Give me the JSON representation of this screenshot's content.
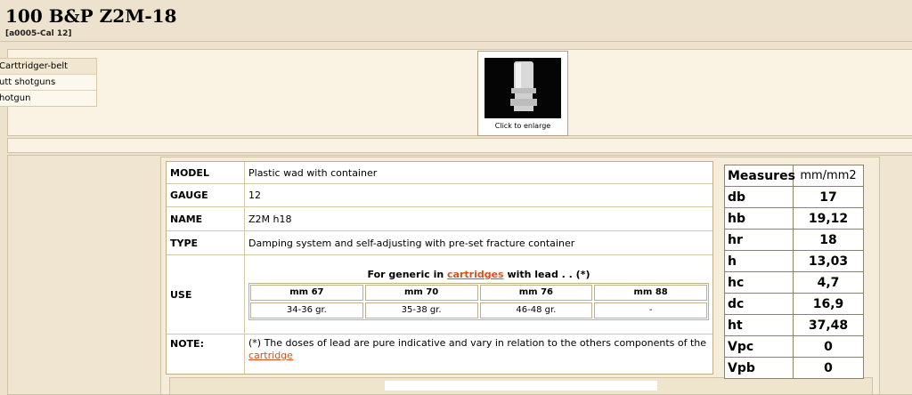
{
  "header": {
    "title": "100 B&P Z2M-18",
    "code": "[a0005-Cal 12]"
  },
  "sidebar": {
    "items": [
      {
        "label": "Carttridger-belt"
      },
      {
        "label": "utt shotguns"
      },
      {
        "label": "hotgun"
      }
    ]
  },
  "thumbnail": {
    "caption": "Click to enlarge"
  },
  "info": {
    "model_label": "MODEL",
    "model_value": "Plastic wad with container",
    "gauge_label": "GAUGE",
    "gauge_value": "12",
    "name_label": "NAME",
    "name_value": "Z2M h18",
    "type_label": "TYPE",
    "type_value": "Damping system and self-adjusting with pre-set fracture container",
    "use_label": "USE",
    "use_heading_pre": "For generic in",
    "use_heading_link": "cartridges",
    "use_heading_post": "with lead . . (*)",
    "use_columns": [
      "mm 67",
      "mm 70",
      "mm 76",
      "mm 88"
    ],
    "use_values": [
      "34-36 gr.",
      "35-38 gr.",
      "46-48 gr.",
      "-"
    ],
    "note_label": "NOTE:",
    "note_text": "(*) The doses of lead are pure indicative and vary in relation to the others components of the",
    "note_link": "cartridge"
  },
  "measures": {
    "header_label": "Measures",
    "header_unit": "mm/mm2",
    "rows": [
      {
        "label": "db",
        "value": "17"
      },
      {
        "label": "hb",
        "value": "19,12"
      },
      {
        "label": "hr",
        "value": "18"
      },
      {
        "label": "h",
        "value": "13,03"
      },
      {
        "label": "hc",
        "value": "4,7"
      },
      {
        "label": "dc",
        "value": "16,9"
      },
      {
        "label": "ht",
        "value": "37,48"
      },
      {
        "label": "Vpc",
        "value": "0"
      },
      {
        "label": "Vpb",
        "value": "0"
      }
    ]
  }
}
